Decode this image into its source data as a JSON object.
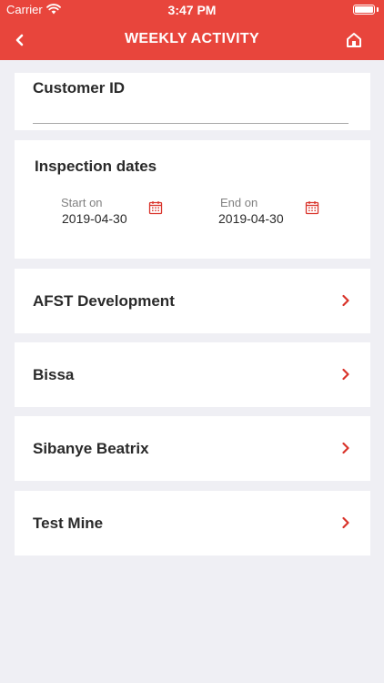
{
  "status_bar": {
    "carrier": "Carrier",
    "time": "3:47 PM"
  },
  "header": {
    "title": "WEEKLY ACTIVITY",
    "back_icon": "chevron-left-icon",
    "home_icon": "home-icon"
  },
  "customer": {
    "label": "Customer ID",
    "value": "",
    "placeholder": ""
  },
  "inspection": {
    "title": "Inspection dates",
    "start": {
      "label": "Start on",
      "value": "2019-04-30"
    },
    "end": {
      "label": "End on",
      "value": "2019-04-30"
    },
    "icon": "calendar-icon"
  },
  "sites": [
    {
      "label": "AFST Development"
    },
    {
      "label": "Bissa"
    },
    {
      "label": "Sibanye Beatrix"
    },
    {
      "label": "Test Mine"
    }
  ],
  "colors": {
    "accent": "#e8453c",
    "background": "#efeff4",
    "card": "#ffffff"
  }
}
